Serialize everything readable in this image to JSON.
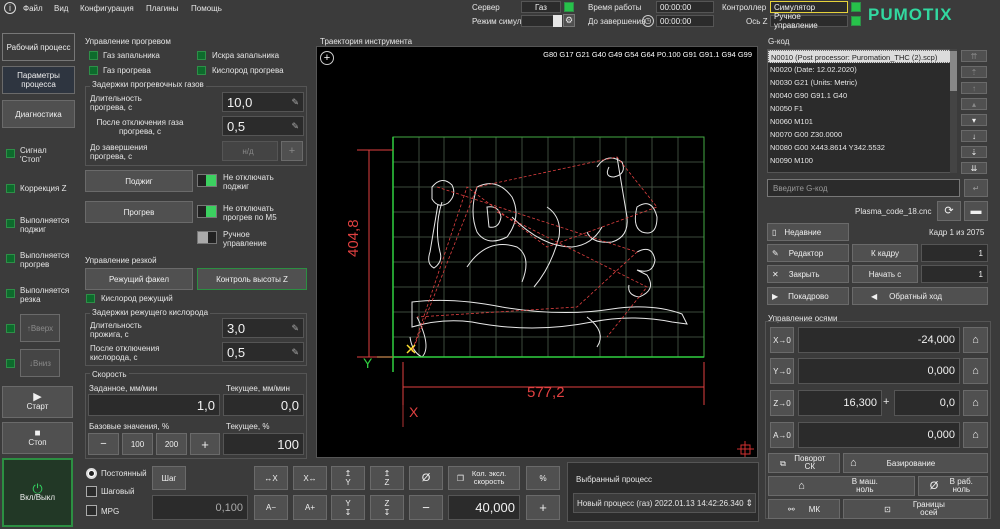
{
  "menu": {
    "items": [
      "Файл",
      "Вид",
      "Конфигурация",
      "Плагины",
      "Помощь"
    ]
  },
  "topbar": {
    "server_label": "Сервер",
    "server_value": "Газ",
    "sim_label": "Режим симуляции",
    "runtime_label": "Время работы",
    "runtime_value": "00:00:00",
    "remaining_label": "До завершения",
    "remaining_value": "00:00:00",
    "controller_label": "Контроллер",
    "controller_value": "Симулятор",
    "axis_z_label": "Ось Z",
    "axis_z_value": "Ручное управление",
    "brand": "PUMOTIX"
  },
  "left_nav": {
    "tabs": [
      "Рабочий процесс",
      "Параметры процесса",
      "Диагностика"
    ],
    "indicators": [
      "Сигнал 'Стоп'",
      "Коррекция Z",
      "Выполняется поджиг",
      "Выполняется прогрев",
      "Выполняется резка"
    ],
    "up_label": "Вверх",
    "down_label": "Вниз",
    "start_label": "Старт",
    "stop_label": "Стоп",
    "power_label": "Вкл/Выкл"
  },
  "preheat": {
    "title": "Управление прогревом",
    "checks": [
      "Газ запальника",
      "Искра запальника",
      "Газ прогрева",
      "Кислород прогрева"
    ],
    "delays_title": "Задержки прогревочных газов",
    "rows": [
      {
        "label": "Длительность прогрева, с",
        "value": "10,0"
      },
      {
        "label": "После отключения газа прогрева, с",
        "value": "0,5"
      },
      {
        "label": "До завершения прогрева, с",
        "value": "н/д"
      }
    ],
    "ignite_label": "Поджиг",
    "no_off_ignite": "Не отключать поджиг",
    "preheat_label": "Прогрев",
    "no_off_preheat": "Не отключать прогрев по М5",
    "manual_label": "Ручное управление"
  },
  "cutting": {
    "title": "Управление резкой",
    "torch_label": "Режущий факел",
    "height_label": "Контроль высоты Z",
    "oxygen_label": "Кислород режущий",
    "delays_title": "Задержки режущего кислорода",
    "rows": [
      {
        "label": "Длительность прожига, с",
        "value": "3,0"
      },
      {
        "label": "После отключения кислорода, с",
        "value": "0,5"
      }
    ]
  },
  "speed": {
    "title": "Скорость",
    "set_label": "Заданное, мм/мин",
    "set_value": "1,0",
    "cur_label": "Текущее, мм/мин",
    "cur_value": "0,0",
    "base_label": "Базовые значения, %",
    "cur_pct_label": "Текущее, %",
    "cur_pct_value": "100",
    "b100": "100",
    "b200": "200"
  },
  "trajectory": {
    "title": "Траектория инструмента",
    "gcode_line": "G80 G17 G21 G40 G49 G54 G64 P0.100 G91 G91.1 G94 G99",
    "dim_h": "577,2",
    "dim_v": "404,8",
    "axis_x": "X",
    "axis_y": "Y"
  },
  "jog": {
    "modes": [
      "Постоянный",
      "Шаговый",
      "MPG"
    ],
    "step_label": "Шаг",
    "step_value": "0,100",
    "axis_buttons": [
      "X",
      "X",
      "Y",
      "Z",
      "Ø",
      "A−",
      "A+",
      "Y",
      "Z"
    ],
    "jog_speed_label": "Кол. эксл. скорость",
    "pct": "%",
    "jog_value": "40,000",
    "plus": "+",
    "minus": "−"
  },
  "process": {
    "title": "Выбранный процесс",
    "value": "Новый процесс (газ) 2022.01.13 14:42:26.340"
  },
  "gcode": {
    "title": "G-код",
    "lines": [
      "N0010 (Post processor: Puromation_THC (2).scp)",
      "N0020 (Date: 12.02.2020)",
      "N0030 G21 (Units: Metric)",
      "N0040 G90 G91.1 G40",
      "N0050 F1",
      "N0060 M101",
      "N0070 G00 Z30.0000",
      "N0080 G00 X443.8614 Y342.5532",
      "N0090 M100"
    ],
    "input_placeholder": "Введите G-код",
    "file_name": "Plasma_code_18.cnc",
    "recent_label": "Недавние",
    "frame_label": "Кадр 1 из 2075",
    "editor_label": "Редактор",
    "to_frame_label": "К кадру",
    "to_frame_value": "1",
    "close_label": "Закрыть",
    "start_from_label": "Начать с",
    "start_from_value": "1",
    "dry_run_label": "Покадрово",
    "reverse_label": "Обратный ход"
  },
  "axes": {
    "title": "Управление осями",
    "rows": [
      {
        "label": "X→0",
        "value": "-24,000"
      },
      {
        "label": "Y→0",
        "value": "0,000"
      },
      {
        "label": "Z→0",
        "value": "16,300",
        "extra": "0,0"
      },
      {
        "label": "A→0",
        "value": "0,000"
      }
    ],
    "rotate_cs": "Поворот СК",
    "homing": "Базирование",
    "to_machine_zero": "В маш. ноль",
    "to_work_zero": "В раб. ноль",
    "mk": "МК",
    "bounds": "Границы осей"
  },
  "colors": {
    "accent_green": "#27c24a",
    "brand": "#32d8a0",
    "trajectory": "#e04040",
    "grid": "#3d4a3d"
  }
}
